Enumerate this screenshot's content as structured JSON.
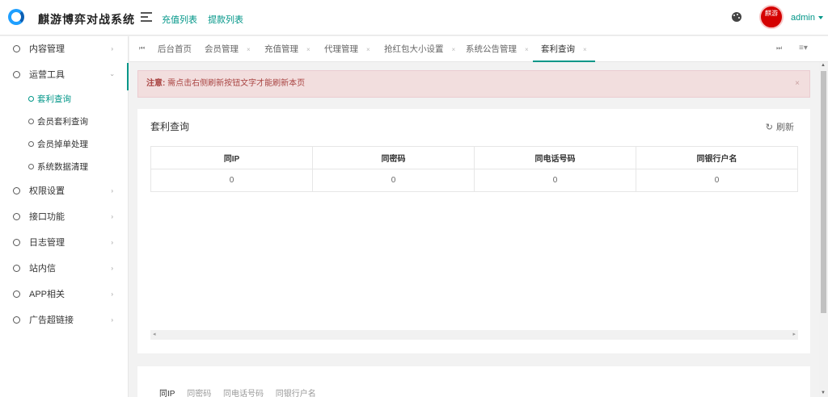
{
  "header": {
    "app_title": "麒游博弈对战系统",
    "top_links": [
      "充值列表",
      "提款列表"
    ],
    "avatar_text": "麒游",
    "user": "admin"
  },
  "sidebar": {
    "items": [
      {
        "label": "内容管理"
      },
      {
        "label": "运营工具"
      },
      {
        "label": "权限设置"
      },
      {
        "label": "接口功能"
      },
      {
        "label": "日志管理"
      },
      {
        "label": "站内信"
      },
      {
        "label": "APP相关"
      },
      {
        "label": "广告超链接"
      }
    ],
    "sub_items": [
      "套利查询",
      "会员套利查询",
      "会员掉单处理",
      "系统数据清理"
    ]
  },
  "tabs": [
    "后台首页",
    "会员管理",
    "充值管理",
    "代理管理",
    "抢红包大小设置",
    "系统公告管理",
    "套利查询"
  ],
  "notice": {
    "label": "注意:",
    "text": "需点击右侧刷新按钮文字才能刷新本页"
  },
  "card": {
    "title": "套利查询",
    "refresh": "刷新",
    "columns": [
      "同IP",
      "同密码",
      "同电话号码",
      "同银行户名"
    ],
    "row": [
      "0",
      "0",
      "0",
      "0"
    ]
  },
  "bottom_tabs": [
    "同IP",
    "同密码",
    "同电话号码",
    "同银行户名"
  ],
  "colors": {
    "accent": "#009688",
    "notice_bg": "#f2dede",
    "notice_text": "#a94442"
  }
}
